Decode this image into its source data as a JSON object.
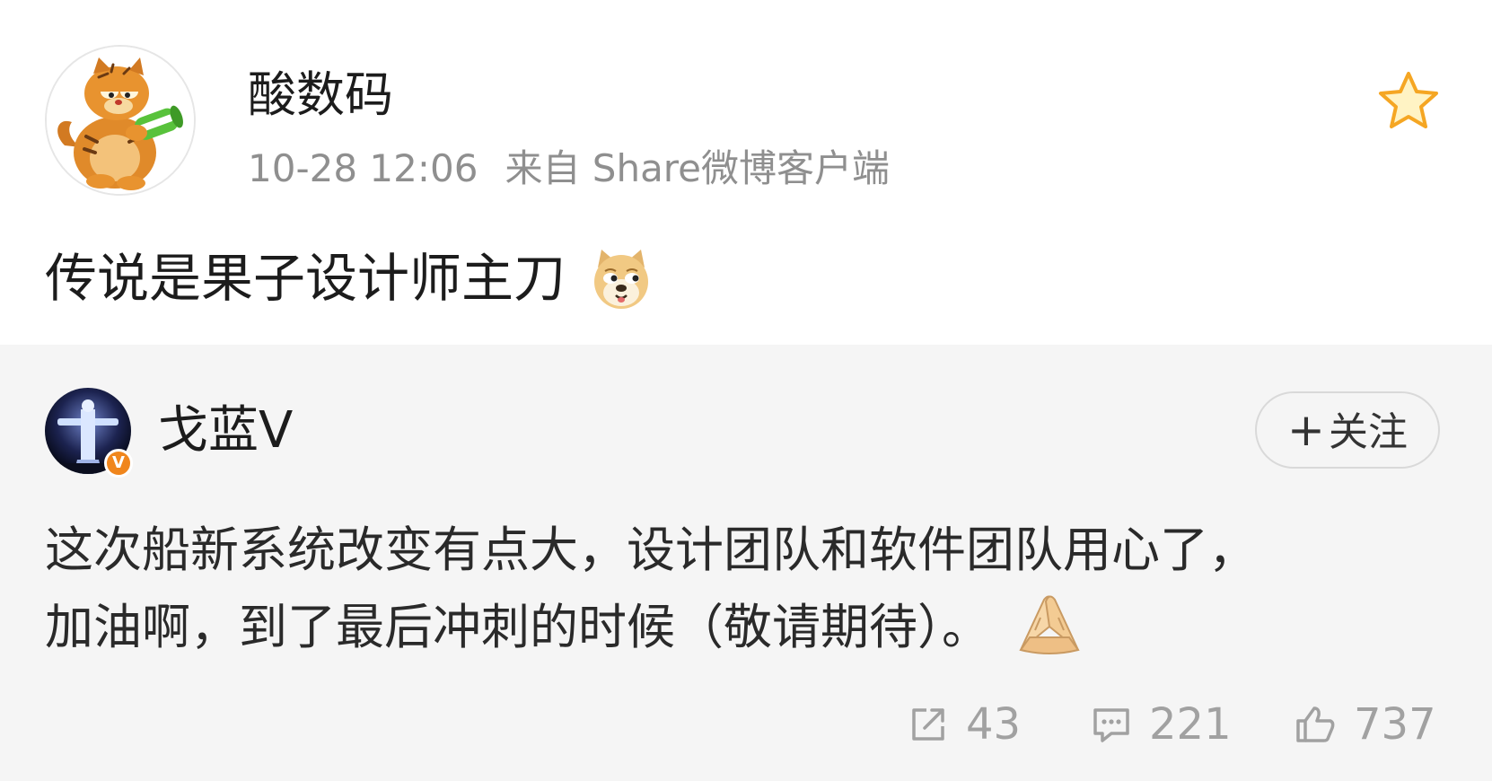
{
  "post": {
    "author": "酸数码",
    "time": "10-28 12:06",
    "source": "来自 Share微博客户端",
    "text": "传说是果子设计师主刀",
    "favorite_icon": "star-outline-icon",
    "emoji": "doge-emoji"
  },
  "repost": {
    "author": "戈蓝V",
    "verified_badge": "V",
    "follow_label": "关注",
    "follow_prefix": "+",
    "text_line1": "这次船新系统改变有点大，设计团队和软件团队用心了，",
    "text_line2": "加油啊，到了最后冲刺的时候（敬请期待）。",
    "emoji": "pray-hands-emoji",
    "counts": {
      "shares": "43",
      "comments": "221",
      "likes": "737"
    }
  },
  "colors": {
    "accent_orange": "#f0861d",
    "star_orange": "#f5a623",
    "muted_text": "#8f8f8f",
    "repost_bg": "#f5f5f5"
  }
}
